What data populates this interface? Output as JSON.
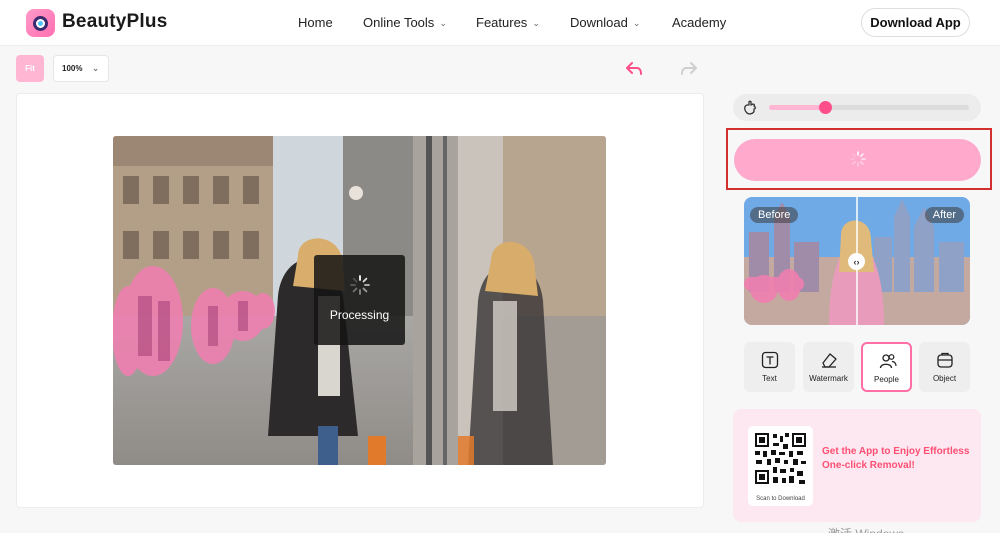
{
  "header": {
    "brand": "BeautyPlus",
    "nav": [
      {
        "label": "Home",
        "has_dropdown": false
      },
      {
        "label": "Online Tools",
        "has_dropdown": true
      },
      {
        "label": "Features",
        "has_dropdown": true
      },
      {
        "label": "Download",
        "has_dropdown": true
      },
      {
        "label": "Academy",
        "has_dropdown": false
      }
    ],
    "download_app": "Download App"
  },
  "toolbar": {
    "fit": "Fit",
    "zoom": "100%"
  },
  "canvas": {
    "processing": "Processing"
  },
  "panel": {
    "brush_size": 0.28,
    "compare_before": "Before",
    "compare_after": "After",
    "tools": [
      {
        "label": "Text",
        "icon": "text-icon",
        "active": false
      },
      {
        "label": "Watermark",
        "icon": "eraser-icon",
        "active": false
      },
      {
        "label": "People",
        "icon": "people-icon",
        "active": true
      },
      {
        "label": "Object",
        "icon": "object-icon",
        "active": false
      }
    ],
    "promo": {
      "scan": "Scan to Download",
      "headline": "Get the App to Enjoy Effortless One-click Removal!"
    }
  },
  "watermark": "激活 Windows",
  "colors": {
    "accent": "#ff4f8b",
    "button_pink": "#ffa9cc",
    "highlight": "#d32f2f"
  }
}
